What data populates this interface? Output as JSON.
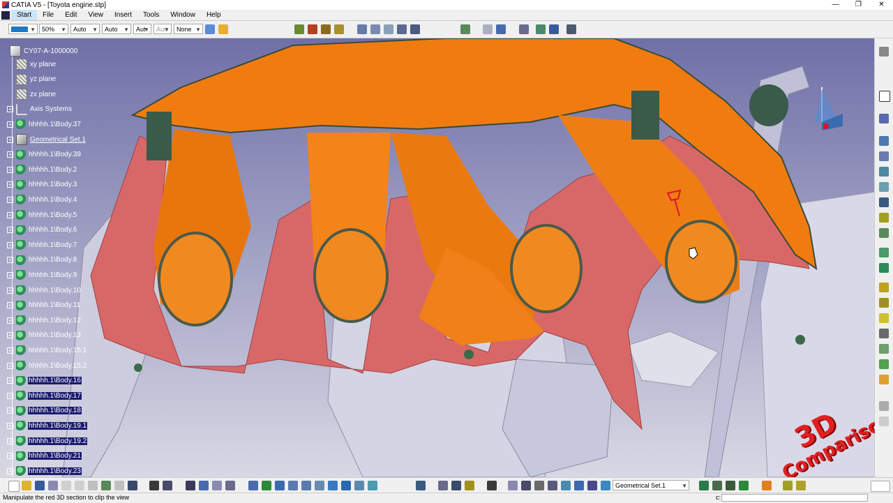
{
  "window": {
    "title": "CATIA V5 - [Toyota engine.stp]",
    "controls": [
      "—",
      "❐",
      "✕"
    ]
  },
  "menu": {
    "items": [
      "Start",
      "File",
      "Edit",
      "View",
      "Insert",
      "Tools",
      "Window",
      "Help"
    ],
    "active": "Start"
  },
  "toolbar": {
    "color_combo": "",
    "transparency": "50%",
    "linetype": "Auto",
    "thickness": "Auto",
    "layer_a": "Aut",
    "layer_b": "Aut",
    "layer_none": "None"
  },
  "tree": {
    "root": "CY07-A-1000000",
    "nodes": [
      {
        "label": "xy plane",
        "icon": "plane-icon",
        "selected": false
      },
      {
        "label": "yz plane",
        "icon": "plane-icon",
        "selected": false
      },
      {
        "label": "zx plane",
        "icon": "plane-icon",
        "selected": false
      },
      {
        "label": "Axis Systems",
        "icon": "axis-icon",
        "selected": false
      },
      {
        "label": "hhhhh.1\\Body.37",
        "icon": "body-icon",
        "selected": false
      },
      {
        "label": "Geometrical Set.1",
        "icon": "geo-icon",
        "selected": false,
        "underline": true
      },
      {
        "label": "hhhhh.1\\Body.39",
        "icon": "body-icon",
        "selected": false
      },
      {
        "label": "hhhhh.1\\Body.2",
        "icon": "body-icon",
        "selected": false
      },
      {
        "label": "hhhhh.1\\Body.3",
        "icon": "body-icon",
        "selected": false
      },
      {
        "label": "hhhhh.1\\Body.4",
        "icon": "body-icon",
        "selected": false
      },
      {
        "label": "hhhhh.1\\Body.5",
        "icon": "body-icon",
        "selected": false
      },
      {
        "label": "hhhhh.1\\Body.6",
        "icon": "body-icon",
        "selected": false
      },
      {
        "label": "hhhhh.1\\Body.7",
        "icon": "body-icon",
        "selected": false
      },
      {
        "label": "hhhhh.1\\Body.8",
        "icon": "body-icon",
        "selected": false
      },
      {
        "label": "hhhhh.1\\Body.9",
        "icon": "body-icon",
        "selected": false
      },
      {
        "label": "hhhhh.1\\Body.10",
        "icon": "body-icon",
        "selected": false
      },
      {
        "label": "hhhhh.1\\Body.11",
        "icon": "body-icon",
        "selected": false
      },
      {
        "label": "hhhhh.1\\Body.12",
        "icon": "body-icon",
        "selected": false
      },
      {
        "label": "hhhhh.1\\Body.13",
        "icon": "body-icon",
        "selected": false
      },
      {
        "label": "hhhhh.1\\Body.15.1",
        "icon": "body-icon",
        "selected": false
      },
      {
        "label": "hhhhh.1\\Body.15.2",
        "icon": "body-icon",
        "selected": false
      },
      {
        "label": "hhhhh.1\\Body.16",
        "icon": "body-icon",
        "selected": true
      },
      {
        "label": "hhhhh.1\\Body.17",
        "icon": "body-icon",
        "selected": true
      },
      {
        "label": "hhhhh.1\\Body.18",
        "icon": "body-icon",
        "selected": true
      },
      {
        "label": "hhhhh.1\\Body.19.1",
        "icon": "body-icon",
        "selected": true
      },
      {
        "label": "hhhhh.1\\Body.19.2",
        "icon": "body-icon",
        "selected": true
      },
      {
        "label": "hhhhh.1\\Body.21",
        "icon": "body-icon",
        "selected": true
      },
      {
        "label": "hhhhh.1\\Body.23",
        "icon": "body-icon",
        "selected": true
      }
    ]
  },
  "bottom_toolbar": {
    "current_set": "Geometrical Set.1"
  },
  "status": {
    "message": "Manipulate the red 3D section to clip the view",
    "cmd_label": "c:",
    "cmd_value": ""
  },
  "watermark": {
    "line1": "3D",
    "line2": "Comparison"
  },
  "colors": {
    "manifold": "#f07c10",
    "gasket": "#d86868",
    "engine": "#d0d0e0",
    "background_top": "#7070a8",
    "selection": "#1a1a6e"
  }
}
